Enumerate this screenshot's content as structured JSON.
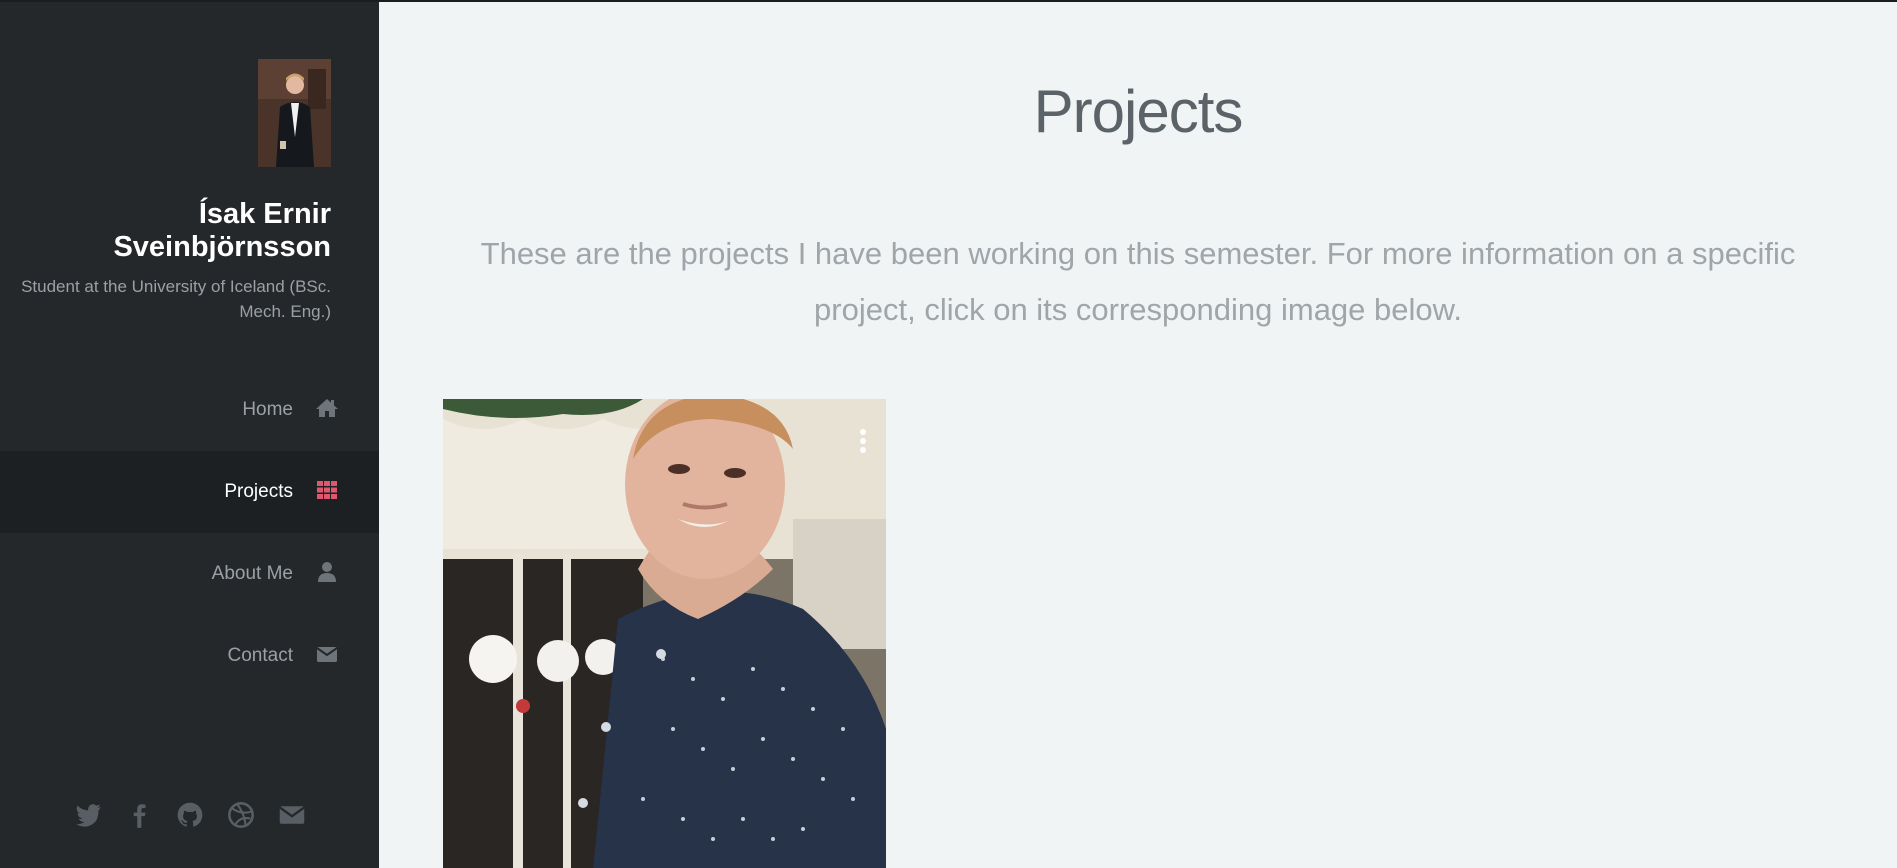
{
  "profile": {
    "name": "Ísak Ernir Sveinbjörnsson",
    "tagline": "Student at the University of Iceland (BSc. Mech. Eng.)"
  },
  "nav": {
    "items": [
      {
        "label": "Home",
        "icon": "home-icon",
        "active": false
      },
      {
        "label": "Projects",
        "icon": "grid-icon",
        "active": true
      },
      {
        "label": "About Me",
        "icon": "user-icon",
        "active": false
      },
      {
        "label": "Contact",
        "icon": "envelope-icon",
        "active": false
      }
    ]
  },
  "social": [
    "twitter-icon",
    "facebook-icon",
    "github-icon",
    "dribbble-icon",
    "envelope-icon"
  ],
  "main": {
    "title": "Projects",
    "intro": "These are the projects I have been working on this semester. For more information on a specific project, click on its corresponding image below."
  },
  "colors": {
    "sidebar_bg": "#25282b",
    "active_bg": "#1d2023",
    "accent": "#e0566f",
    "main_bg": "#f1f4f5"
  }
}
